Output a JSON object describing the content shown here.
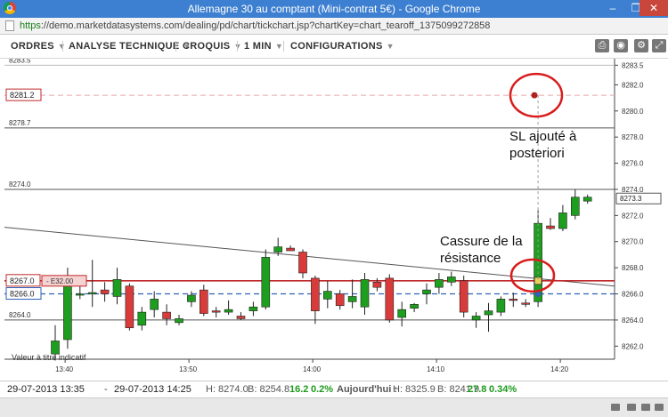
{
  "window": {
    "title": "Allemagne 30 au comptant (Mini-contrat 5€) - Google Chrome",
    "url_scheme": "https",
    "url_rest": "://demo.marketdatasystems.com/dealing/pd/chart/tickchart.jsp?chartKey=chart_tearoff_1375099272858"
  },
  "toolbar": {
    "menus": [
      "ORDRES",
      "ANALYSE TECHNIQUE",
      "CROQUIS",
      "1 MIN",
      "CONFIGURATIONS"
    ],
    "icons": [
      "print-icon",
      "camera-icon",
      "gear-icon",
      "expand-icon"
    ]
  },
  "chart_data": {
    "type": "candlestick",
    "x_ticks": [
      "13:40",
      "13:50",
      "14:00",
      "14:10",
      "14:20"
    ],
    "y_ticks": [
      "8262.0",
      "8264.0",
      "8266.0",
      "8268.0",
      "8270.0",
      "8272.0",
      "8274.0",
      "8276.0",
      "8278.0",
      "8280.0",
      "8282.0",
      "8283.5"
    ],
    "ylim": [
      8261.0,
      8284.0
    ],
    "candles": [
      {
        "o": 8261.4,
        "h": 8263.6,
        "l": 8260.9,
        "c": 8262.4
      },
      {
        "o": 8262.5,
        "h": 8268.0,
        "l": 8261.8,
        "c": 8266.6
      },
      {
        "o": 8266.0,
        "h": 8267.2,
        "l": 8265.6,
        "c": 8266.0
      },
      {
        "o": 8266.1,
        "h": 8268.6,
        "l": 8265.0,
        "c": 8266.1
      },
      {
        "o": 8266.3,
        "h": 8266.9,
        "l": 8265.4,
        "c": 8266.0
      },
      {
        "o": 8265.8,
        "h": 8268.0,
        "l": 8265.2,
        "c": 8267.1
      },
      {
        "o": 8266.6,
        "h": 8266.8,
        "l": 8263.2,
        "c": 8263.4
      },
      {
        "o": 8263.6,
        "h": 8265.0,
        "l": 8263.2,
        "c": 8264.6
      },
      {
        "o": 8264.8,
        "h": 8266.2,
        "l": 8264.2,
        "c": 8265.6
      },
      {
        "o": 8264.6,
        "h": 8265.2,
        "l": 8263.6,
        "c": 8264.1
      },
      {
        "o": 8263.8,
        "h": 8264.4,
        "l": 8263.6,
        "c": 8264.1
      },
      {
        "o": 8265.4,
        "h": 8266.2,
        "l": 8265.0,
        "c": 8265.9
      },
      {
        "o": 8266.3,
        "h": 8266.7,
        "l": 8264.3,
        "c": 8264.5
      },
      {
        "o": 8264.7,
        "h": 8265.0,
        "l": 8264.2,
        "c": 8264.6
      },
      {
        "o": 8264.6,
        "h": 8265.5,
        "l": 8264.4,
        "c": 8264.8
      },
      {
        "o": 8264.3,
        "h": 8264.6,
        "l": 8264.0,
        "c": 8264.1
      },
      {
        "o": 8264.7,
        "h": 8265.4,
        "l": 8264.3,
        "c": 8265.0
      },
      {
        "o": 8265.0,
        "h": 8269.4,
        "l": 8264.8,
        "c": 8268.8
      },
      {
        "o": 8269.2,
        "h": 8270.3,
        "l": 8268.9,
        "c": 8269.6
      },
      {
        "o": 8269.5,
        "h": 8269.7,
        "l": 8269.3,
        "c": 8269.3
      },
      {
        "o": 8269.2,
        "h": 8269.4,
        "l": 8267.2,
        "c": 8267.6
      },
      {
        "o": 8267.2,
        "h": 8267.4,
        "l": 8263.7,
        "c": 8264.7
      },
      {
        "o": 8265.6,
        "h": 8267.0,
        "l": 8264.9,
        "c": 8266.2
      },
      {
        "o": 8266.0,
        "h": 8266.3,
        "l": 8264.8,
        "c": 8265.1
      },
      {
        "o": 8265.4,
        "h": 8267.1,
        "l": 8264.9,
        "c": 8265.8
      },
      {
        "o": 8265.0,
        "h": 8267.6,
        "l": 8264.4,
        "c": 8267.1
      },
      {
        "o": 8266.9,
        "h": 8267.2,
        "l": 8266.2,
        "c": 8266.5
      },
      {
        "o": 8267.2,
        "h": 8267.5,
        "l": 8263.8,
        "c": 8264.0
      },
      {
        "o": 8264.2,
        "h": 8265.4,
        "l": 8263.5,
        "c": 8264.8
      },
      {
        "o": 8264.9,
        "h": 8265.3,
        "l": 8264.6,
        "c": 8265.2
      },
      {
        "o": 8266.0,
        "h": 8266.8,
        "l": 8265.2,
        "c": 8266.3
      },
      {
        "o": 8266.5,
        "h": 8267.6,
        "l": 8266.0,
        "c": 8267.1
      },
      {
        "o": 8266.9,
        "h": 8267.7,
        "l": 8266.6,
        "c": 8267.3
      },
      {
        "o": 8267.0,
        "h": 8267.4,
        "l": 8264.2,
        "c": 8264.6
      },
      {
        "o": 8264.0,
        "h": 8264.6,
        "l": 8263.4,
        "c": 8264.3
      },
      {
        "o": 8264.4,
        "h": 8265.3,
        "l": 8263.1,
        "c": 8264.7
      },
      {
        "o": 8264.6,
        "h": 8265.8,
        "l": 8264.3,
        "c": 8265.6
      },
      {
        "o": 8265.6,
        "h": 8266.1,
        "l": 8265.0,
        "c": 8265.5
      },
      {
        "o": 8265.3,
        "h": 8265.6,
        "l": 8265.0,
        "c": 8265.2
      },
      {
        "o": 8265.4,
        "h": 8272.4,
        "l": 8265.0,
        "c": 8271.4
      },
      {
        "o": 8271.2,
        "h": 8271.8,
        "l": 8270.9,
        "c": 8271.0
      },
      {
        "o": 8271.0,
        "h": 8272.8,
        "l": 8270.8,
        "c": 8272.2
      },
      {
        "o": 8272.0,
        "h": 8274.0,
        "l": 8271.7,
        "c": 8273.4
      },
      {
        "o": 8273.1,
        "h": 8273.6,
        "l": 8272.9,
        "c": 8273.4
      }
    ],
    "horizontal_lines": [
      {
        "label": "8283.5",
        "price": 8283.5,
        "style": "solid-gray"
      },
      {
        "label": "8278.7",
        "price": 8278.7,
        "style": "solid-dark"
      },
      {
        "label": "8274.0",
        "price": 8274.0,
        "style": "solid-dark"
      },
      {
        "label": "8264.0",
        "price": 8264.0,
        "style": "solid-dark"
      }
    ],
    "stop_line": {
      "label": "8281.2",
      "price": 8281.2
    },
    "order_line": {
      "label": "8267.0",
      "price": 8267.0,
      "tag": "- E32.00"
    },
    "entry_line": {
      "label": "8266.0",
      "price": 8266.0
    },
    "current_price": {
      "label": "8273.3",
      "price": 8273.3
    },
    "trendline": {
      "from": {
        "bar": 0,
        "price": 8271.1
      },
      "to": {
        "bar": 48,
        "price": 8266.6
      }
    },
    "annotations": {
      "sl_text": [
        "SL ajouté à",
        "posteriori"
      ],
      "break_text": [
        "Cassure de la",
        "résistance"
      ],
      "watermark": "Valeur à titre indicatif"
    }
  },
  "status": {
    "from": "29-07-2013 13:35",
    "to": "29-07-2013 14:25",
    "dash": "-",
    "high": "H: 8274.0",
    "low": "B: 8254.8",
    "change": "16.2",
    "change_pct": "0.2%",
    "today_label": "Aujourd'hui :",
    "today_high": "H: 8325.9",
    "today_low": "B: 8241.9",
    "today_change": "27.8",
    "today_pct": "0.34%"
  },
  "colors": {
    "up": "#1e9e1e",
    "down": "#d93b3b",
    "order": "#c0282a",
    "entry": "#2d62b6",
    "annotation": "#d91c1c"
  }
}
